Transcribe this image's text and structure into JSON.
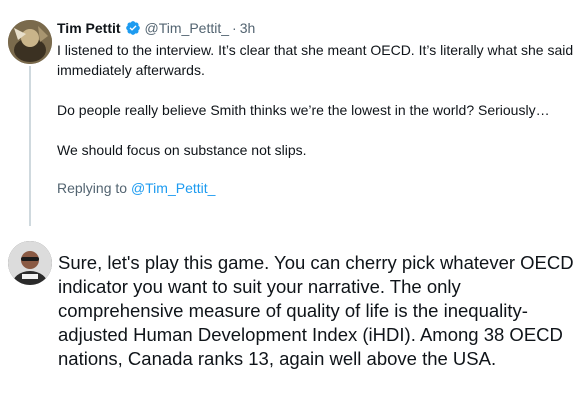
{
  "tweet": {
    "author_name": "Tim Pettit",
    "author_handle": "@Tim_Pettit_",
    "separator": "·",
    "time": "3h",
    "paragraphs": [
      "I listened to the interview. It’s clear that she meant OECD. It’s literally what she said immediately afterwards.",
      "Do people really believe Smith thinks we’re the lowest in the world? Seriously…",
      "We should focus on substance not slips."
    ],
    "replying_prefix": "Replying to",
    "replying_handle": "@Tim_Pettit_"
  },
  "reply": {
    "text": "Sure, let's play this game. You can cherry pick whatever OECD indicator you want to suit your narrative. The only comprehensive measure of quality of life is the inequality-adjusted Human Development Index (iHDI). Among 38 OECD nations, Canada ranks 13, again well above the USA."
  },
  "colors": {
    "accent": "#1d9bf0",
    "secondary_text": "#536471",
    "thread_line": "#cfd9de"
  },
  "icons": {
    "verified": "verified-badge-icon"
  }
}
